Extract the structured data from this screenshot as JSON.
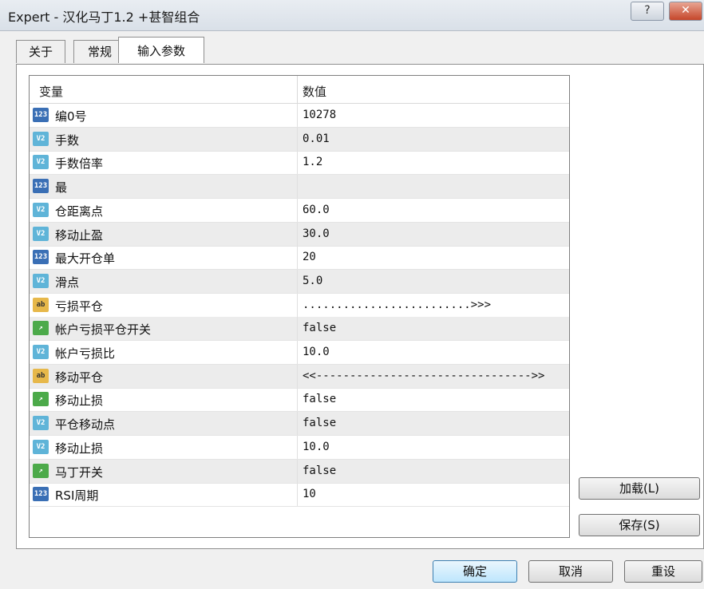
{
  "window": {
    "title": "Expert - 汉化马丁1.2 +甚智组合"
  },
  "titlebar": {
    "help_label": "?",
    "close_label": "✕"
  },
  "tabs": [
    {
      "label": "关于"
    },
    {
      "label": "常规"
    },
    {
      "label": "输入参数"
    }
  ],
  "grid": {
    "headers": {
      "variable": "变量",
      "value": "数值"
    },
    "rows": [
      {
        "type": "123",
        "name": "编0号",
        "value": "10278"
      },
      {
        "type": "V2",
        "name": "手数",
        "value": "0.01"
      },
      {
        "type": "V2",
        "name": "手数倍率",
        "value": "1.2"
      },
      {
        "type": "123",
        "name": "最",
        "value": ""
      },
      {
        "type": "V2",
        "name": "仓距离点",
        "value": "60.0"
      },
      {
        "type": "V2",
        "name": "移动止盈",
        "value": "30.0"
      },
      {
        "type": "123",
        "name": "最大开仓单",
        "value": "20"
      },
      {
        "type": "V2",
        "name": "滑点",
        "value": "5.0"
      },
      {
        "type": "ab",
        "name": "亏损平仓",
        "value": ".........................>>>"
      },
      {
        "type": "bool",
        "name": "帐户亏损平仓开关",
        "value": "false"
      },
      {
        "type": "V2",
        "name": "帐户亏损比",
        "value": "10.0"
      },
      {
        "type": "ab",
        "name": "移动平仓",
        "value": "<<-------------------------------->>"
      },
      {
        "type": "bool",
        "name": "移动止损",
        "value": "false"
      },
      {
        "type": "V2",
        "name": "平仓移动点",
        "value": "false"
      },
      {
        "type": "V2",
        "name": "移动止损",
        "value": "10.0"
      },
      {
        "type": "bool",
        "name": "马丁开关",
        "value": "false"
      },
      {
        "type": "123",
        "name": "RSI周期",
        "value": "10"
      }
    ]
  },
  "buttons": {
    "load": "加载(L)",
    "save": "保存(S)",
    "ok": "确定",
    "cancel": "取消",
    "reset": "重设"
  },
  "icon_names": {
    "123": "integer-icon",
    "V2": "double-icon",
    "ab": "string-icon",
    "bool": "bool-icon"
  }
}
